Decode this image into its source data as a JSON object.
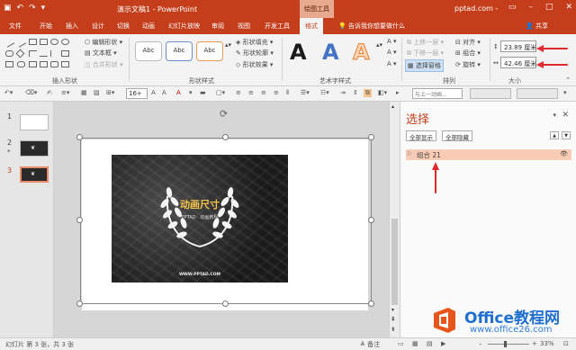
{
  "window": {
    "title": "演示文稿1 - PowerPoint",
    "context_tab": "绘图工具",
    "account": "pptad.com",
    "account_sep": "-"
  },
  "tabs": [
    "文件",
    "开始",
    "插入",
    "设计",
    "切换",
    "动画",
    "幻灯片放映",
    "审阅",
    "视图",
    "开发工具",
    "格式"
  ],
  "tell_me": "告诉我你想要做什么",
  "share": "共享",
  "ribbon": {
    "insert_shapes": {
      "label": "插入形状",
      "edit_shape": "编辑形状",
      "text_box": "文本框",
      "merge_shapes": "合并形状"
    },
    "shape_styles": {
      "label": "形状样式",
      "preset": "Abc",
      "fill": "形状填充",
      "outline": "形状轮廓",
      "effects": "形状效果"
    },
    "wordart_styles": {
      "label": "艺术字样式",
      "letters": [
        "A",
        "A",
        "A"
      ],
      "colors": [
        "#1a1a1a",
        "#4472c4",
        "#ed7d31"
      ]
    },
    "arrange": {
      "label": "排列",
      "bring_forward": "上移一层",
      "send_backward": "下移一层",
      "selection_pane": "选择窗格",
      "align": "对齐",
      "group": "组合",
      "rotate": "旋转"
    },
    "size": {
      "label": "大小",
      "height": "23.89 厘米",
      "width": "42.46 厘米"
    }
  },
  "format_bar": {
    "font_size": "16+",
    "font_color": "A",
    "animation_dropdown": "与上一动画..."
  },
  "slides": [
    {
      "num": "1"
    },
    {
      "num": "2",
      "marker": "*"
    },
    {
      "num": "3"
    }
  ],
  "slide_content": {
    "title": "动画尺寸",
    "subtitle": "PPTAD · 动画教程",
    "url": "WWW.PPTAD.COM"
  },
  "selection_pane": {
    "title": "选择",
    "show_all": "全部显示",
    "hide_all": "全部隐藏",
    "item": "组合 21"
  },
  "statusbar": {
    "slide_info": "幻灯片 第 3 张，共 3 张",
    "notes": "备注",
    "zoom": "33%"
  },
  "watermark": {
    "brand": "Office教程网",
    "url": "www.office26.com"
  },
  "colors": {
    "accent": "#c43e1c",
    "selection_highlight": "#f8cbb5",
    "annotation_arrow": "#e0282e"
  }
}
